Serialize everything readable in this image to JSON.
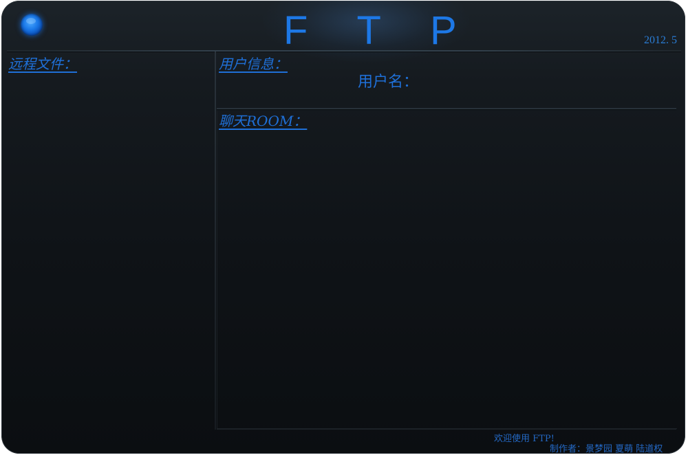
{
  "app": {
    "title": "F T P",
    "version": "2012. 5"
  },
  "left_panel": {
    "label": "远程文件："
  },
  "user_panel": {
    "label": "用户信息：",
    "username_label": "用户名："
  },
  "chat_panel": {
    "label": "聊天ROOM："
  },
  "footer": {
    "welcome": "欢迎使用 FTP!",
    "credits": "制作者：景梦园 夏萌 陆道权"
  },
  "colors": {
    "accent": "#1f70d8",
    "background": "#0f1317"
  },
  "icons": {
    "status_orb": "status-orb-icon"
  }
}
